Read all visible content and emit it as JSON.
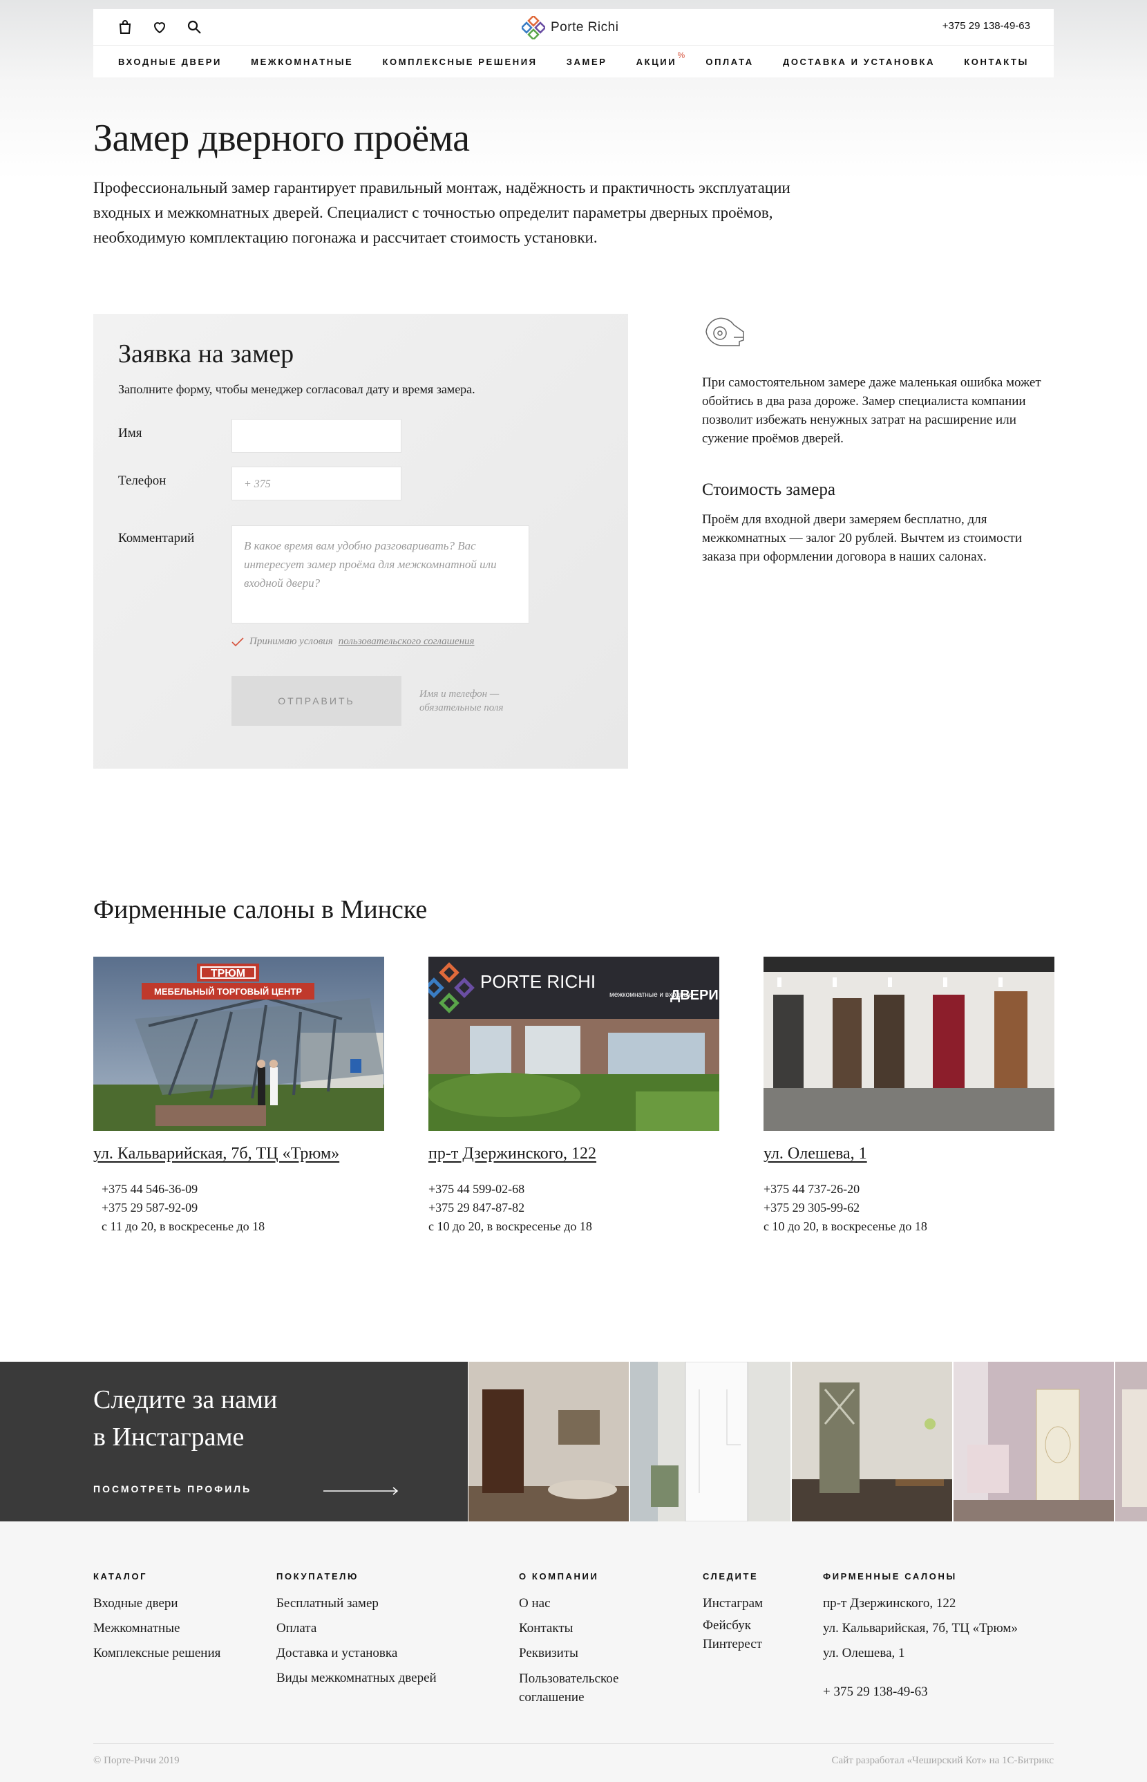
{
  "header": {
    "brand": "Porte Richi",
    "phone": "+375 29 138-49-63",
    "icons": [
      "bag-icon",
      "heart-icon",
      "search-icon"
    ],
    "nav": [
      {
        "label": "ВХОДНЫЕ ДВЕРИ"
      },
      {
        "label": "МЕЖКОМНАТНЫЕ"
      },
      {
        "label": "КОМПЛЕКСНЫЕ РЕШЕНИЯ"
      },
      {
        "label": "ЗАМЕР"
      },
      {
        "label": "АКЦИИ",
        "badge": "%"
      },
      {
        "label": "ОПЛАТА"
      },
      {
        "label": "ДОСТАВКА И УСТАНОВКА"
      },
      {
        "label": "КОНТАКТЫ"
      }
    ]
  },
  "hero": {
    "title": "Замер дверного проёма",
    "lead": "Профессиональный замер гарантирует правильный монтаж, надёжность и практичность эксплуатации входных и межкомнатных дверей. Специалист с точностью определит параметры дверных проёмов, необходимую комплектацию погонажа и рассчитает стоимость установки."
  },
  "form": {
    "title": "Заявка на замер",
    "subtitle": "Заполните форму, чтобы менеджер согласовал дату и время замера.",
    "name_label": "Имя",
    "name_value": "",
    "phone_label": "Телефон",
    "phone_placeholder": "+ 375",
    "comment_label": "Комментарий",
    "comment_placeholder": "В какое время вам удобно разговаривать? Вас интересует замер проёма для межкомнатной или входной двери?",
    "agree_text": "Принимаю условия",
    "agree_link": "пользовательского соглашения",
    "submit_label": "ОТПРАВИТЬ",
    "required_note": "Имя и телефон — обязательные поля"
  },
  "info": {
    "icon": "tape-measure-icon",
    "paragraph": "При самостоятельном замере даже маленькая ошибка может обойтись в два раза дороже. Замер специалиста компании позволит избежать ненужных затрат на расширение или сужение проёмов дверей.",
    "cost_title": "Стоимость замера",
    "cost_text": "Проём для входной двери замеряем бесплатно, для межкомнатных — залог 20 рублей. Вычтем из стоимости заказа при оформлении договора в наших салонах."
  },
  "salons": {
    "title": "Фирменные салоны в Минске",
    "items": [
      {
        "address": "ул. Кальварийская, 7б, ТЦ «Трюм»",
        "phone1": "+375 44 546-36-09",
        "phone2": "+375 29 587-92-09",
        "hours": "с 11 до 20, в воскресенье до 18",
        "sign": "ТРЮМ",
        "banner": "МЕБЕЛЬНЫЙ ТОРГОВЫЙ ЦЕНТР"
      },
      {
        "address": "пр-т Дзержинского, 122",
        "phone1": "+375 44 599-02-68",
        "phone2": "+375 29 847-87-82",
        "hours": "с 10 до 20, в воскресенье до 18",
        "sign": "PORTE RICHI",
        "banner": "межкомнатные и входные",
        "banner2": "ДВЕРИ"
      },
      {
        "address": "ул. Олешева, 1",
        "phone1": "+375 44 737-26-20",
        "phone2": "+375 29 305-99-62",
        "hours": "с 10 до 20, в воскресенье до 18"
      }
    ]
  },
  "instagram": {
    "title_line1": "Следите за нами",
    "title_line2": "в Инстаграме",
    "link": "ПОСМОТРЕТЬ ПРОФИЛЬ"
  },
  "footer": {
    "catalog": {
      "title": "КАТАЛОГ",
      "links": [
        "Входные двери",
        "Межкомнатные",
        "Комплексные решения"
      ]
    },
    "buyer": {
      "title": "ПОКУПАТЕЛЮ",
      "links": [
        "Бесплатный замер",
        "Оплата",
        "Доставка и установка",
        "Виды межкомнатных дверей"
      ]
    },
    "company": {
      "title": "О КОМПАНИИ",
      "links": [
        "О нас",
        "Контакты",
        "Реквизиты",
        "Пользовательское соглашение"
      ]
    },
    "follow": {
      "title": "СЛЕДИТЕ",
      "links": [
        "Инстаграм",
        "Фейсбук",
        "Пинтерест"
      ]
    },
    "salons": {
      "title": "ФИРМЕННЫЕ САЛОНЫ",
      "links": [
        "пр-т Дзержинского, 122",
        "ул. Кальварийская, 7б, ТЦ «Трюм»",
        "ул. Олешева, 1"
      ],
      "phone": "+ 375 29 138-49-63"
    },
    "copyright": "© Порте-Ричи 2019",
    "developer": "Сайт разработал «Чеширский Кот» на 1С-Битрикс"
  },
  "colors": {
    "accent": "#d6533d",
    "dark": "#3a3a3a",
    "form_bg": "#ececec"
  }
}
